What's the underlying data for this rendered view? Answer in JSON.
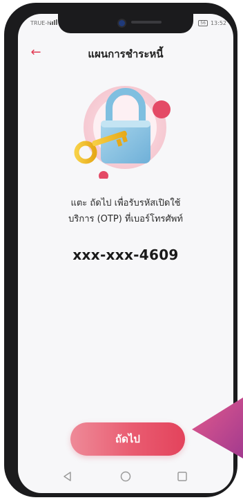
{
  "status_bar": {
    "carrier": "TRUE-H",
    "battery": "56",
    "time": "13:52"
  },
  "header": {
    "back_icon": "arrow-left-icon",
    "title": "แผนการชำระหนี้"
  },
  "illustration": {
    "icon": "padlock-key-icon"
  },
  "message": {
    "line1": "แตะ ถัดไป เพื่อรับรหัสเปิดใช้",
    "line2": "บริการ (OTP) ที่เบอร์โทรศัพท์"
  },
  "phone_number": "xxx-xxx-4609",
  "next_button": {
    "label": "ถัดไป"
  },
  "nav_bar": {
    "icons": [
      "nav-back-icon",
      "nav-home-icon",
      "nav-recent-icon"
    ]
  },
  "colors": {
    "accent": "#e23b54",
    "button_start": "#ee8a98",
    "button_end": "#e3435c",
    "background": "#f7f7f9",
    "pointer": "#d0457e"
  }
}
